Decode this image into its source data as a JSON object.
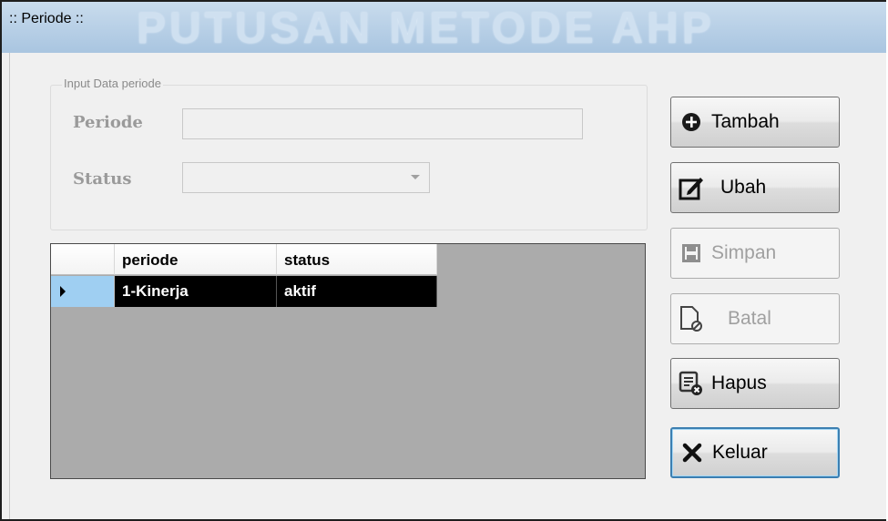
{
  "window": {
    "title": ":: Periode ::",
    "watermark": "PUTUSAN METODE AHP"
  },
  "form": {
    "group_label": "Input Data periode",
    "periode_label": "Periode",
    "periode_value": "",
    "status_label": "Status",
    "status_value": ""
  },
  "grid": {
    "columns": [
      "periode",
      "status"
    ],
    "rows": [
      {
        "periode": "1-Kinerja",
        "status": "aktif"
      }
    ]
  },
  "buttons": {
    "tambah": "Tambah",
    "ubah": "Ubah",
    "simpan": "Simpan",
    "batal": "Batal",
    "hapus": "Hapus",
    "keluar": "Keluar"
  },
  "icons": {
    "tambah": "plus-circle-icon",
    "ubah": "edit-icon",
    "simpan": "save-icon",
    "batal": "cancel-document-icon",
    "hapus": "delete-list-icon",
    "keluar": "close-icon"
  }
}
